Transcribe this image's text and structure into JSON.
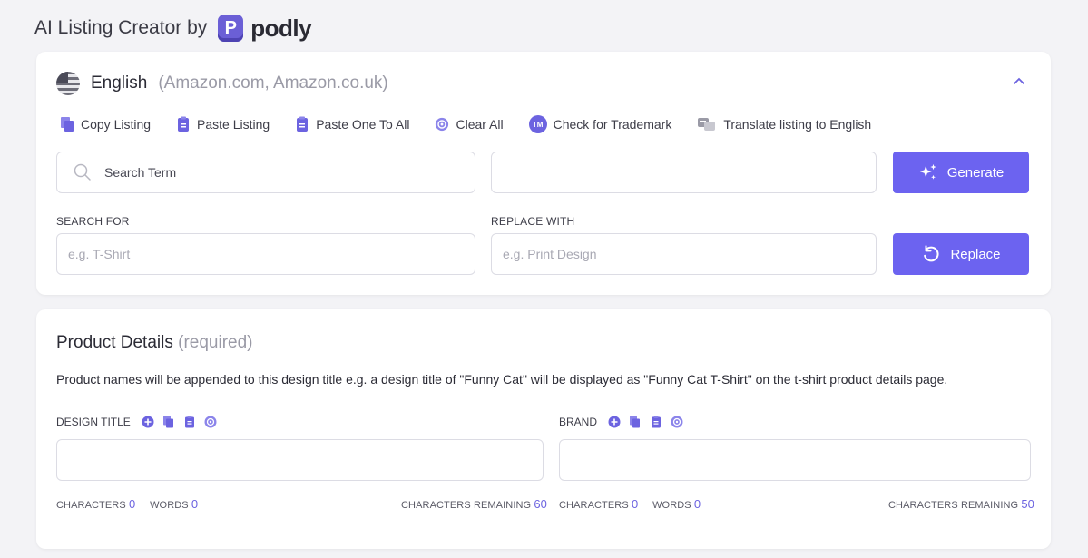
{
  "header": {
    "title": "AI Listing Creator by",
    "logo_mark": "P",
    "logo_text": "podly"
  },
  "language": {
    "name": "English",
    "markets": "(Amazon.com, Amazon.co.uk)"
  },
  "toolbar": {
    "copy": "Copy Listing",
    "paste": "Paste Listing",
    "paste_all": "Paste One To All",
    "clear": "Clear All",
    "trademark": "Check for Trademark",
    "trademark_badge": "TM",
    "translate": "Translate listing to English"
  },
  "search": {
    "placeholder": "Search Term",
    "value": "",
    "second_value": ""
  },
  "generate_label": "Generate",
  "replace": {
    "search_label": "SEARCH FOR",
    "search_placeholder": "e.g. T-Shirt",
    "replace_label": "REPLACE WITH",
    "replace_placeholder": "e.g. Print Design",
    "button_label": "Replace"
  },
  "product": {
    "title": "Product Details",
    "required": "(required)",
    "description": "Product names will be appended to this design title e.g. a design title of \"Funny Cat\" will be displayed as \"Funny Cat T-Shirt\" on the t-shirt product details page.",
    "design_title": {
      "label": "DESIGN TITLE",
      "value": "",
      "characters_label": "CHARACTERS",
      "characters": "0",
      "words_label": "WORDS",
      "words": "0",
      "remaining_label": "CHARACTERS REMAINING",
      "remaining": "60"
    },
    "brand": {
      "label": "BRAND",
      "value": "",
      "characters_label": "CHARACTERS",
      "characters": "0",
      "words_label": "WORDS",
      "words": "0",
      "remaining_label": "CHARACTERS REMAINING",
      "remaining": "50"
    }
  },
  "colors": {
    "accent": "#6c63f0",
    "background": "#f3f3f6"
  }
}
